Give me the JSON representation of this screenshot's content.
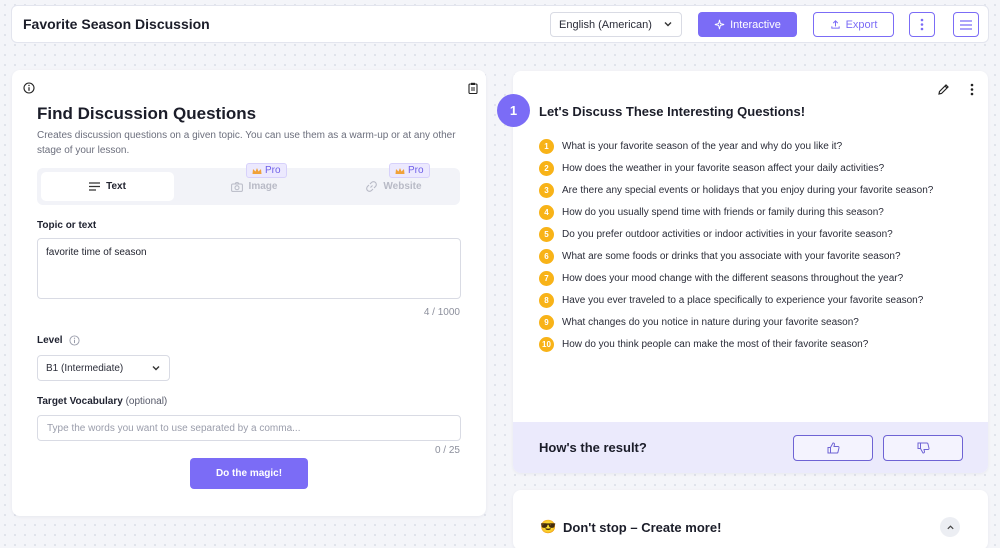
{
  "header": {
    "title": "Favorite Season Discussion",
    "language": "English (American)",
    "interactive_label": "Interactive",
    "export_label": "Export"
  },
  "generator": {
    "title": "Find Discussion Questions",
    "description": "Creates discussion questions on a given topic. You can use them as a warm-up or at any other stage of your lesson.",
    "tabs": [
      {
        "label": "Text",
        "icon": "text-lines-icon",
        "active": true,
        "pro": false
      },
      {
        "label": "Image",
        "icon": "camera-icon",
        "active": false,
        "pro": true
      },
      {
        "label": "Website",
        "icon": "link-icon",
        "active": false,
        "pro": true
      }
    ],
    "pro_label": "Pro",
    "topic_label": "Topic or text",
    "topic_value": "favorite time of season",
    "topic_counter": "4 / 1000",
    "level_label": "Level",
    "level_value": "B1 (Intermediate)",
    "vocab_label": "Target Vocabulary",
    "vocab_optional": "(optional)",
    "vocab_placeholder": "Type the words you want to use separated by a comma...",
    "vocab_counter": "0 / 25",
    "submit_label": "Do the magic!"
  },
  "result": {
    "step": "1",
    "title": "Let's Discuss These Interesting Questions!",
    "questions": [
      {
        "num": "1",
        "text": "What is your favorite season of the year and why do you like it?"
      },
      {
        "num": "2",
        "text": "How does the weather in your favorite season affect your daily activities?"
      },
      {
        "num": "3",
        "text": "Are there any special events or holidays that you enjoy during your favorite season?"
      },
      {
        "num": "4",
        "text": "How do you usually spend time with friends or family during this season?"
      },
      {
        "num": "5",
        "text": "Do you prefer outdoor activities or indoor activities in your favorite season?"
      },
      {
        "num": "6",
        "text": "What are some foods or drinks that you associate with your favorite season?"
      },
      {
        "num": "7",
        "text": "How does your mood change with the different seasons throughout the year?"
      },
      {
        "num": "8",
        "text": "Have you ever traveled to a place specifically to experience your favorite season?"
      },
      {
        "num": "9",
        "text": "What changes do you notice in nature during your favorite season?"
      },
      {
        "num": "10",
        "text": "How do you think people can make the most of their favorite season?"
      }
    ],
    "feedback_label": "How's the result?"
  },
  "more": {
    "emoji": "😎",
    "title": "Don't stop – Create more!"
  },
  "colors": {
    "accent": "#7b6cf6",
    "number_badge": "#f8b318",
    "feedback_bg": "#ebeafc"
  }
}
